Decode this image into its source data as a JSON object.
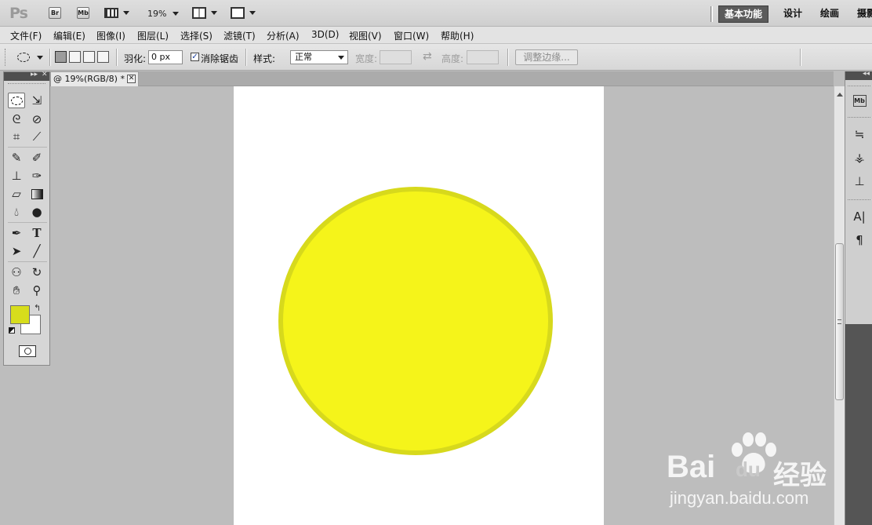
{
  "app": {
    "logo": "Ps"
  },
  "appbar": {
    "bridge_label": "Br",
    "minibridge_label": "Mb",
    "zoom": "19%",
    "workspaces": [
      "基本功能",
      "设计",
      "绘画",
      "摄影"
    ],
    "active_workspace": "基本功能"
  },
  "menu": [
    "文件(F)",
    "编辑(E)",
    "图像(I)",
    "图层(L)",
    "选择(S)",
    "滤镜(T)",
    "分析(A)",
    "3D(D)",
    "视图(V)",
    "窗口(W)",
    "帮助(H)"
  ],
  "options": {
    "feather_label": "羽化:",
    "feather_value": "0 px",
    "antialias_label": "消除锯齿",
    "antialias_checked": "✓",
    "style_label": "样式:",
    "style_value": "正常",
    "width_label": "宽度:",
    "swap_icon": "⇄",
    "height_label": "高度:",
    "refine_edge_label": "调整边缘..."
  },
  "document": {
    "tab_title": "@ 19%(RGB/8) *",
    "close_glyph": "✕",
    "shape_fill": "#f5f41a",
    "shape_stroke": "#d7d91c"
  },
  "colors": {
    "foreground": "#d7dd1c",
    "background": "#ffffff"
  },
  "tools_panel": {
    "collapse": "▸▸",
    "close": "✕"
  },
  "dock": {
    "collapse": "◂◂"
  },
  "watermark": {
    "brand": "Bai",
    "brand_cn": "经验",
    "brand_du": "du",
    "url": "jingyan.baidu.com"
  }
}
